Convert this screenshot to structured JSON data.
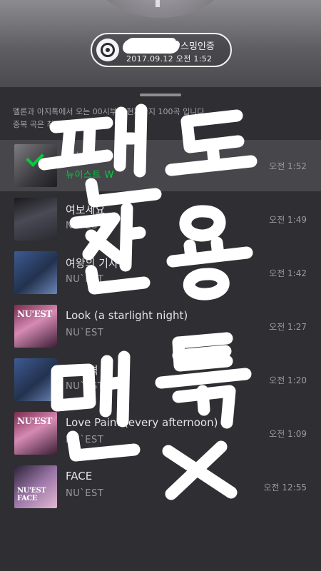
{
  "stream_badge": {
    "text": "스밍인증",
    "date": "2017.09.12 오전 1:52"
  },
  "description": [
    "멜론과 아지톡에서 오는 00시부터 현재까지 100곡 입니다.",
    "중복 곡은 최근 보여..."
  ],
  "tracks": [
    {
      "title": "여보세요",
      "artist": "뉴이스트 W",
      "time": "오전 1:52",
      "selected": true,
      "color": "#00cd3c"
    },
    {
      "title": "여보세요",
      "artist": "NU`EST",
      "time": "오전 1:49",
      "selected": false
    },
    {
      "title": "여왕의 기사",
      "artist": "NU`EST",
      "time": "오전 1:42",
      "selected": false
    },
    {
      "title": "Look (a starlight night)",
      "artist": "NU`EST",
      "time": "오전 1:27",
      "selected": false,
      "cover_text": "NU'EST"
    },
    {
      "title": "Tr 체격",
      "artist": "NU`EST",
      "time": "오전 1:20",
      "selected": false
    },
    {
      "title": "Love Paint (every afternoon)",
      "artist": "NU`EST",
      "time": "오전 1:09",
      "selected": false,
      "cover_text": "NU'EST"
    },
    {
      "title": "FACE",
      "artist": "NU`EST",
      "time": "오전 12:55",
      "selected": false,
      "cover_text": "NU'EST FACE"
    }
  ],
  "handwriting": "팬도 전용 멘톡 X",
  "colors": {
    "accent": "#00cd3c",
    "panel": "#2f2f33",
    "header": "#5e5e62",
    "annotation": "#ffffff"
  }
}
